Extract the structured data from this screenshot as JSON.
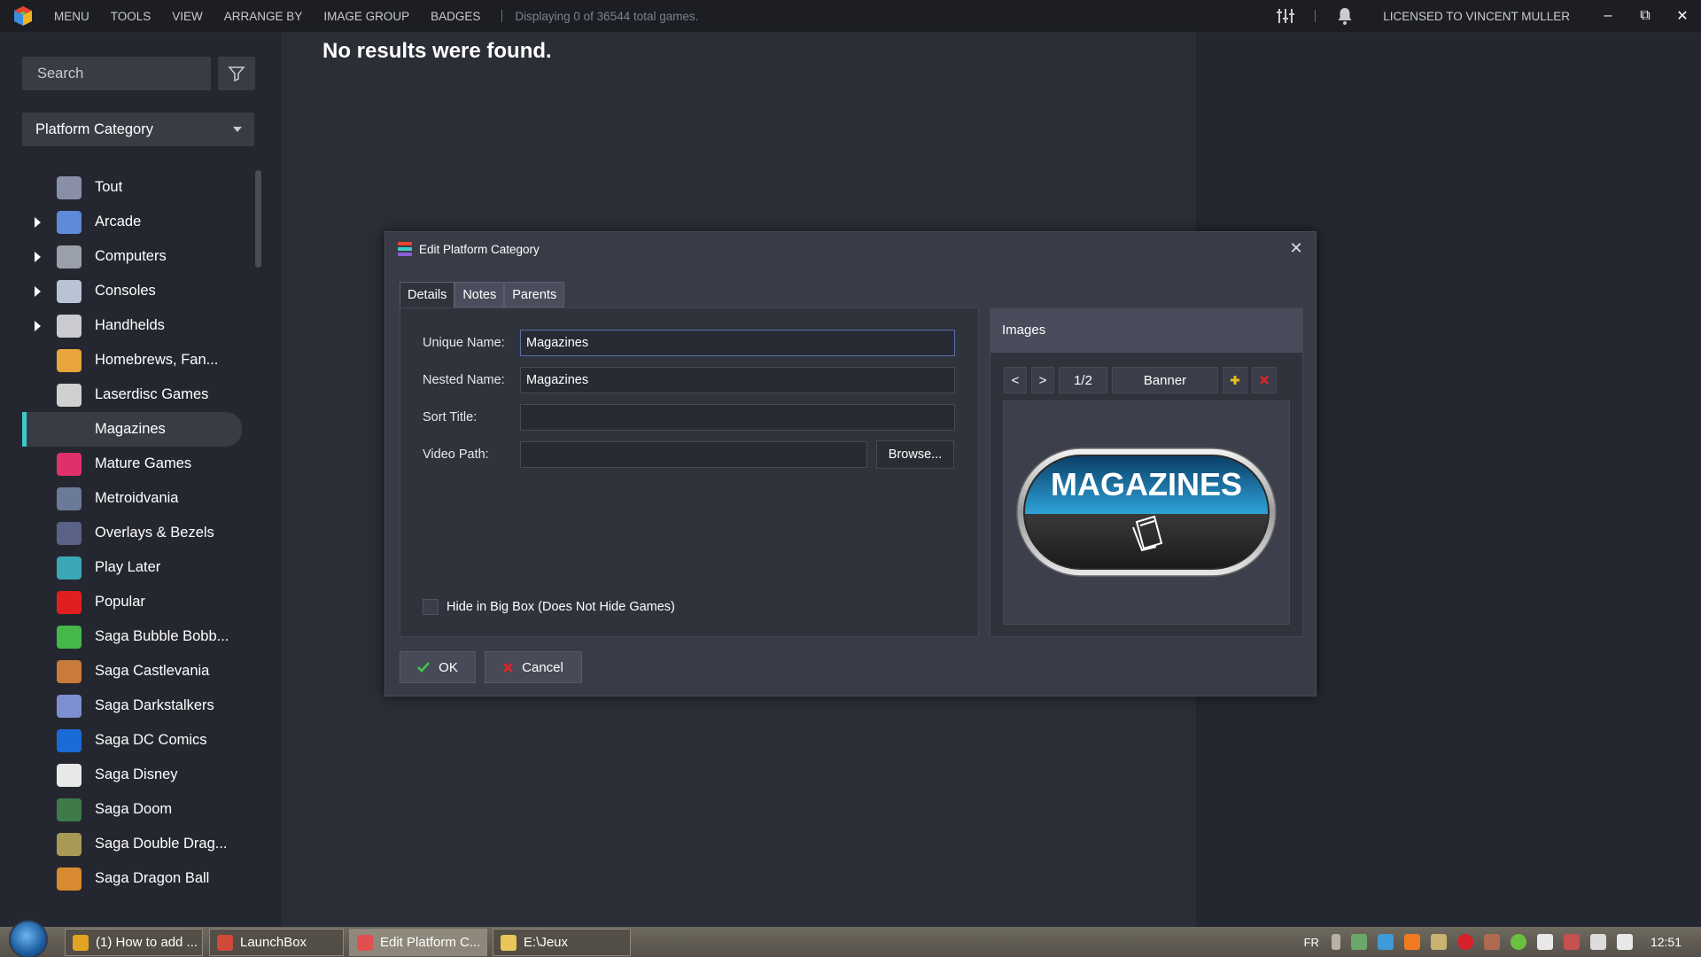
{
  "topbar": {
    "menu_items": [
      "MENU",
      "TOOLS",
      "VIEW",
      "ARRANGE BY",
      "IMAGE GROUP",
      "BADGES"
    ],
    "status": "Displaying 0 of 36544 total games.",
    "licensed": "LICENSED TO VINCENT MULLER",
    "min_glyph": "–",
    "restore_glyph": "⧉",
    "close_glyph": "✕"
  },
  "sidebar": {
    "search_placeholder": "Search",
    "dropdown_label": "Platform Category",
    "items": [
      {
        "label": "Tout",
        "expandable": false,
        "selected": false,
        "icon": "tout-icon",
        "color": "#8a8fa8"
      },
      {
        "label": "Arcade",
        "expandable": true,
        "selected": false,
        "icon": "arcade-icon",
        "color": "#5f8ad8"
      },
      {
        "label": "Computers",
        "expandable": true,
        "selected": false,
        "icon": "computer-icon",
        "color": "#9aa0aa"
      },
      {
        "label": "Consoles",
        "expandable": true,
        "selected": false,
        "icon": "console-icon",
        "color": "#b8c3d6"
      },
      {
        "label": "Handhelds",
        "expandable": true,
        "selected": false,
        "icon": "handheld-icon",
        "color": "#c9cbd0"
      },
      {
        "label": "Homebrews, Fan...",
        "expandable": false,
        "selected": false,
        "icon": "beer-icon",
        "color": "#e8a53c"
      },
      {
        "label": "Laserdisc Games",
        "expandable": false,
        "selected": false,
        "icon": "laserdisc-icon",
        "color": "#d0d0d0"
      },
      {
        "label": "Magazines",
        "expandable": false,
        "selected": true,
        "icon": "",
        "color": ""
      },
      {
        "label": "Mature Games",
        "expandable": false,
        "selected": false,
        "icon": "lips-icon",
        "color": "#e0306a"
      },
      {
        "label": "Metroidvania",
        "expandable": false,
        "selected": false,
        "icon": "metroidvania-icon",
        "color": "#6c7a99"
      },
      {
        "label": "Overlays & Bezels",
        "expandable": false,
        "selected": false,
        "icon": "bezel-icon",
        "color": "#5a6288"
      },
      {
        "label": "Play Later",
        "expandable": false,
        "selected": false,
        "icon": "play-later-icon",
        "color": "#3aa7b5"
      },
      {
        "label": "Popular",
        "expandable": false,
        "selected": false,
        "icon": "heart-icon",
        "color": "#e02020"
      },
      {
        "label": "Saga Bubble Bobb...",
        "expandable": false,
        "selected": false,
        "icon": "bubble-bobble-icon",
        "color": "#46b84a"
      },
      {
        "label": "Saga Castlevania",
        "expandable": false,
        "selected": false,
        "icon": "castlevania-icon",
        "color": "#c87b3a"
      },
      {
        "label": "Saga Darkstalkers",
        "expandable": false,
        "selected": false,
        "icon": "darkstalkers-icon",
        "color": "#7b8fd2"
      },
      {
        "label": "Saga DC Comics",
        "expandable": false,
        "selected": false,
        "icon": "dc-comics-icon",
        "color": "#1a6ad8"
      },
      {
        "label": "Saga Disney",
        "expandable": false,
        "selected": false,
        "icon": "disney-icon",
        "color": "#e8e8e8"
      },
      {
        "label": "Saga Doom",
        "expandable": false,
        "selected": false,
        "icon": "doom-icon",
        "color": "#3f7a4a"
      },
      {
        "label": "Saga Double Drag...",
        "expandable": false,
        "selected": false,
        "icon": "double-dragon-icon",
        "color": "#a89a55"
      },
      {
        "label": "Saga Dragon Ball",
        "expandable": false,
        "selected": false,
        "icon": "dragon-ball-icon",
        "color": "#d88a30"
      }
    ]
  },
  "main": {
    "no_results": "No results were found."
  },
  "dialog": {
    "title": "Edit Platform Category",
    "close_glyph": "✕",
    "tabs": [
      "Details",
      "Notes",
      "Parents"
    ],
    "fields": {
      "unique_name_label": "Unique Name:",
      "unique_name_value": "Magazines",
      "nested_name_label": "Nested Name:",
      "nested_name_value": "Magazines",
      "sort_title_label": "Sort Title:",
      "sort_title_value": "",
      "video_path_label": "Video Path:",
      "video_path_value": "",
      "browse_label": "Browse..."
    },
    "hide_bigbox_label": "Hide in Big Box (Does Not Hide Games)",
    "hide_bigbox_checked": false,
    "images": {
      "header": "Images",
      "prev": "<",
      "next": ">",
      "counter": "1/2",
      "image_type": "Banner",
      "banner_text": "MAGAZINES"
    },
    "ok_label": "OK",
    "cancel_label": "Cancel"
  },
  "taskbar": {
    "tasks": [
      {
        "label": "(1) How to add ...",
        "active": false,
        "icon": "chrome-icon",
        "color": "#e4a423"
      },
      {
        "label": "LaunchBox",
        "active": false,
        "icon": "launchbox-icon",
        "color": "#d04a3a"
      },
      {
        "label": "Edit Platform C...",
        "active": true,
        "icon": "edit-platform-icon",
        "color": "#e05050"
      },
      {
        "label": "E:\\Jeux",
        "active": false,
        "icon": "folder-icon",
        "color": "#e8c65a"
      }
    ],
    "lang": "FR",
    "clock": "12:51"
  }
}
